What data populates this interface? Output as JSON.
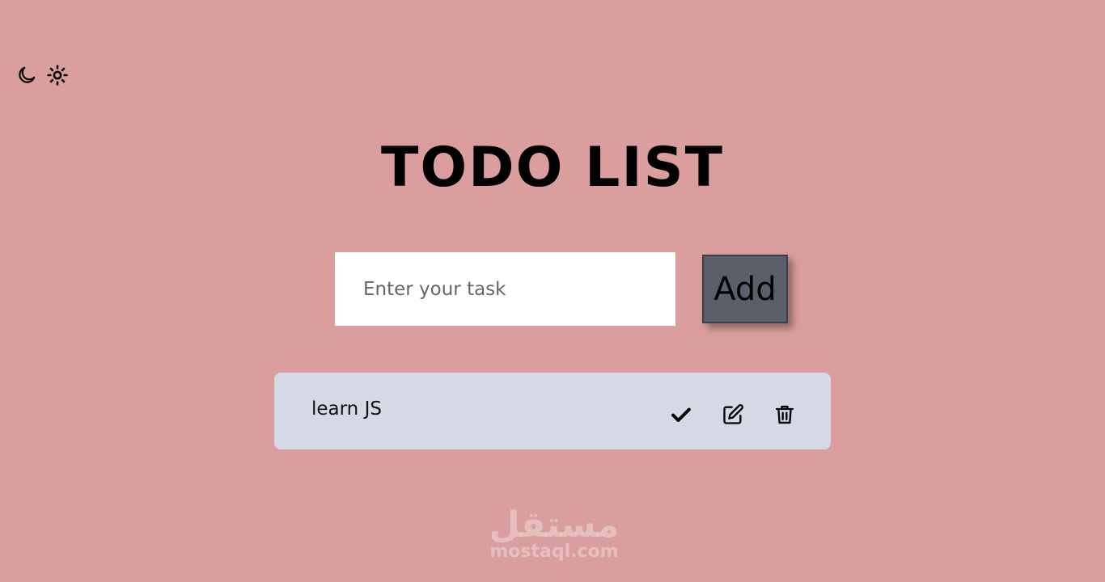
{
  "theme_toggle": {
    "dark_icon": "moon-icon",
    "light_icon": "sun-icon"
  },
  "header": {
    "title": "TODO LIST"
  },
  "form": {
    "input_placeholder": "Enter your task",
    "input_value": "",
    "add_label": "Add"
  },
  "tasks": [
    {
      "text": "learn JS",
      "actions": [
        "check-icon",
        "edit-icon",
        "trash-icon"
      ]
    }
  ],
  "watermark": {
    "arabic": "مستقل",
    "latin": "mostaql.com"
  },
  "colors": {
    "background": "#d99e9d",
    "input_bg": "#ffffff",
    "button_bg": "#5b5f69",
    "task_bg": "#d4d9e5"
  }
}
